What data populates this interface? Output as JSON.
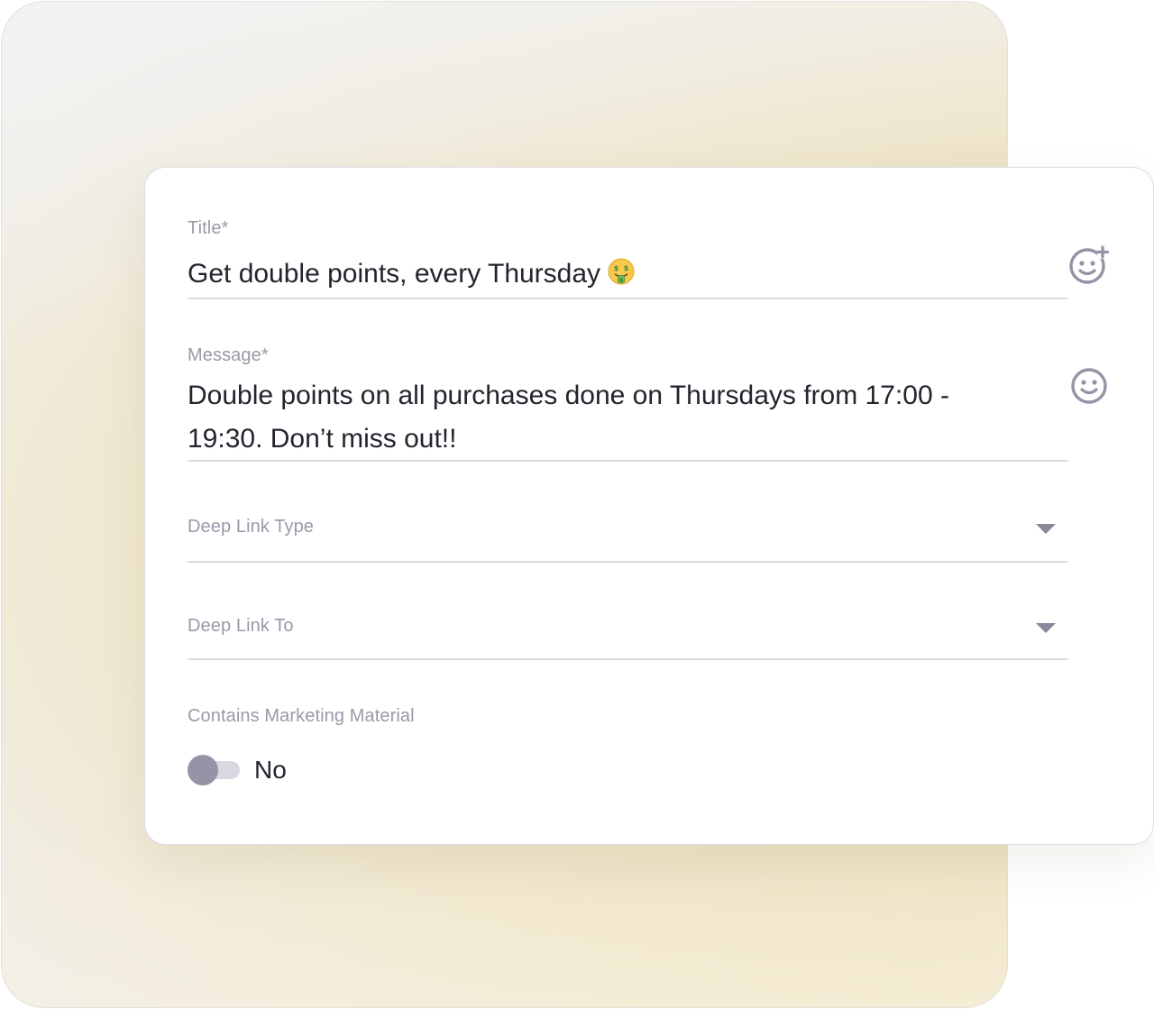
{
  "form": {
    "title_field": {
      "label": "Title*",
      "value": "Get double points, every Thursday",
      "trailing_emoji": "money-mouth-face",
      "side_icon": "add-emoji-icon"
    },
    "message_field": {
      "label": "Message*",
      "value_line1": "Double points on all purchases done on Thursdays from 17:00 -",
      "value_line2": "19:30. Don’t miss out!!",
      "side_icon": "emoji-icon"
    },
    "deep_link_type": {
      "label": "Deep Link Type",
      "icon": "chevron-down-icon"
    },
    "deep_link_to": {
      "label": "Deep Link To",
      "icon": "chevron-down-icon"
    },
    "marketing": {
      "label": "Contains Marketing Material",
      "toggle_on": false,
      "toggle_state_label": "No"
    }
  },
  "colors": {
    "label": "#9b98a8",
    "text": "#25232e",
    "underline": "#dcdbe1",
    "icon": "#9693a6",
    "toggle_track": "#d9d7e0",
    "toggle_thumb": "#9693a6"
  }
}
